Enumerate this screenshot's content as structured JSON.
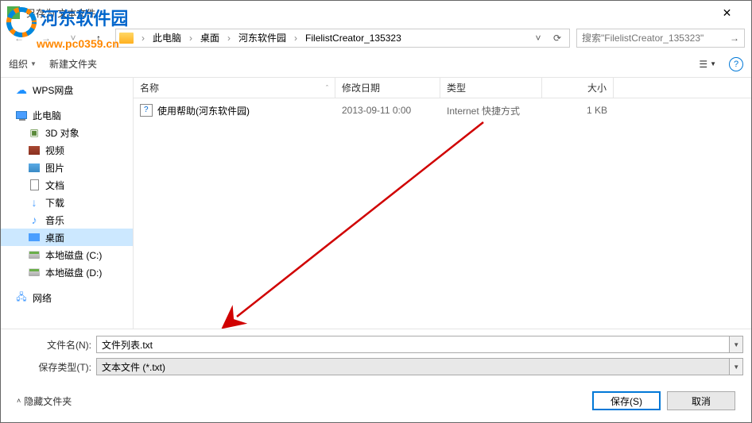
{
  "titlebar": {
    "title": "另存为 文本文件"
  },
  "watermark": {
    "text": "河东软件园",
    "url": "www.pc0359.cn"
  },
  "nav": {
    "breadcrumb": [
      "此电脑",
      "桌面",
      "河东软件园",
      "FilelistCreator_135323"
    ],
    "search_placeholder": "搜索\"FilelistCreator_135323\""
  },
  "toolbar": {
    "organize": "组织",
    "new_folder": "新建文件夹"
  },
  "sidebar": {
    "wps": "WPS网盘",
    "pc": "此电脑",
    "items": [
      "3D 对象",
      "视频",
      "图片",
      "文档",
      "下载",
      "音乐",
      "桌面",
      "本地磁盘 (C:)",
      "本地磁盘 (D:)"
    ],
    "network": "网络"
  },
  "headers": {
    "name": "名称",
    "date": "修改日期",
    "type": "类型",
    "size": "大小"
  },
  "files": [
    {
      "name": "使用帮助(河东软件园)",
      "date": "2013-09-11 0:00",
      "type": "Internet 快捷方式",
      "size": "1 KB"
    }
  ],
  "form": {
    "filename_label": "文件名(N):",
    "filename_value": "文件列表.txt",
    "filetype_label": "保存类型(T):",
    "filetype_value": "文本文件 (*.txt)"
  },
  "footer": {
    "hide_folders": "隐藏文件夹",
    "save": "保存(S)",
    "cancel": "取消"
  }
}
